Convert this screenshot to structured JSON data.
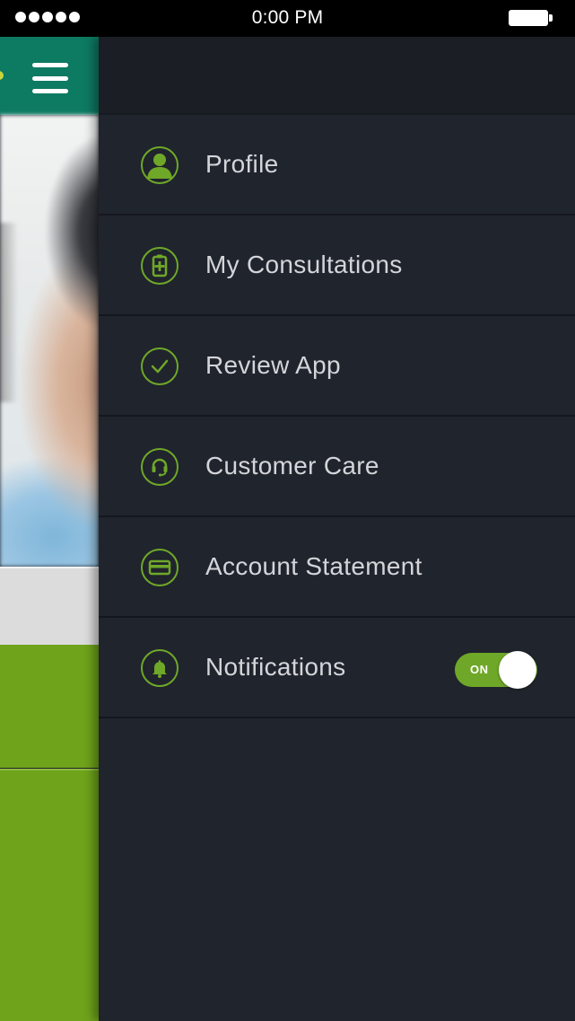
{
  "status_bar": {
    "time": "0:00 PM",
    "signal_dots": 5,
    "battery_level": 1.0
  },
  "background_app": {
    "header_color": "#0d7a62",
    "accent_green": "#6fa31b",
    "menu_icon": "hamburger-icon"
  },
  "drawer": {
    "background": "#20242d",
    "accent": "#6fa828",
    "items": [
      {
        "label": "Profile",
        "icon": "person-icon"
      },
      {
        "label": "My Consultations",
        "icon": "medical-clipboard-icon"
      },
      {
        "label": "Review App",
        "icon": "checkmark-icon"
      },
      {
        "label": "Customer Care",
        "icon": "headset-icon"
      },
      {
        "label": "Account Statement",
        "icon": "credit-card-icon"
      },
      {
        "label": "Notifications",
        "icon": "bell-icon"
      }
    ],
    "notifications_toggle": {
      "state_label": "ON",
      "enabled": true
    }
  }
}
